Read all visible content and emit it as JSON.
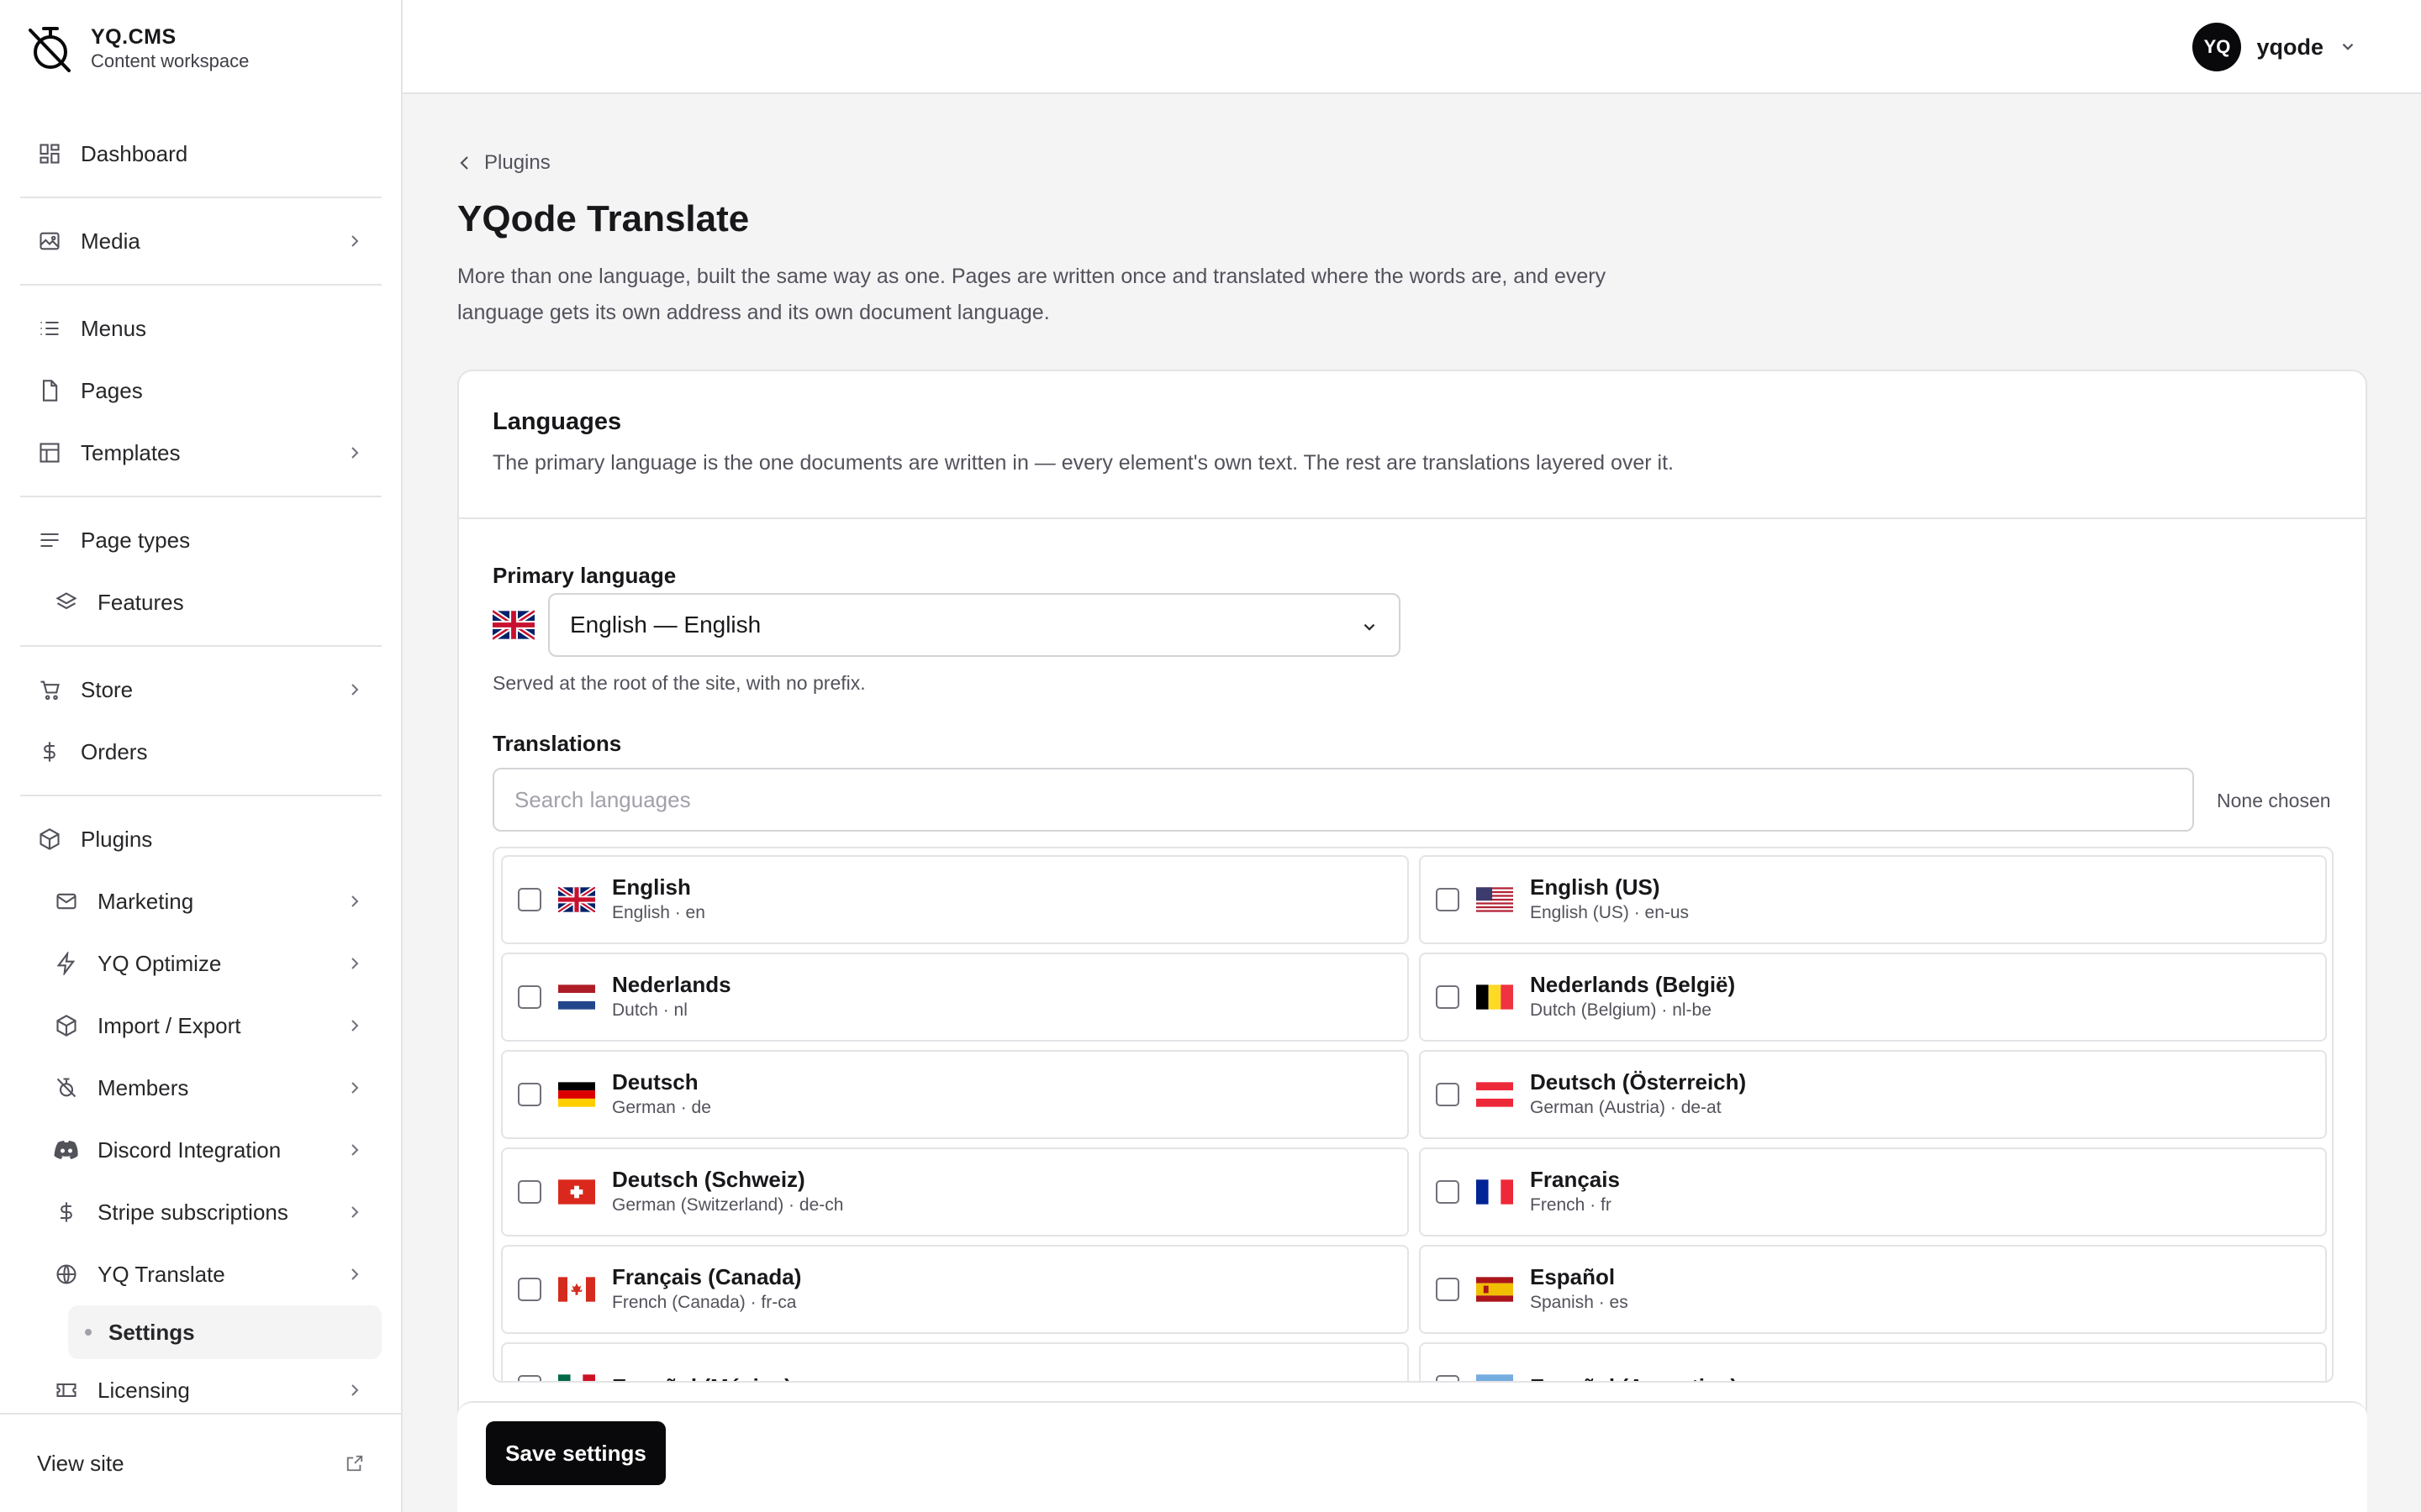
{
  "brand": {
    "name": "YQ.CMS",
    "subtitle": "Content workspace"
  },
  "sidebar": {
    "items": [
      {
        "label": "Dashboard"
      },
      {
        "label": "Media"
      },
      {
        "label": "Menus"
      },
      {
        "label": "Pages"
      },
      {
        "label": "Templates"
      },
      {
        "label": "Page types"
      },
      {
        "label": "Features"
      },
      {
        "label": "Store"
      },
      {
        "label": "Orders"
      },
      {
        "label": "Plugins"
      },
      {
        "label": "Marketing"
      },
      {
        "label": "YQ Optimize"
      },
      {
        "label": "Import / Export"
      },
      {
        "label": "Members"
      },
      {
        "label": "Discord Integration"
      },
      {
        "label": "Stripe subscriptions"
      },
      {
        "label": "YQ Translate"
      },
      {
        "label": "Settings"
      },
      {
        "label": "Licensing"
      }
    ],
    "footer": {
      "label": "View site"
    }
  },
  "user": {
    "initials": "YQ",
    "name": "yqode"
  },
  "page": {
    "breadcrumb": "Plugins",
    "title": "YQode Translate",
    "description": "More than one language, built the same way as one. Pages are written once and translated where the words are, and every language gets its own address and its own document language."
  },
  "languages_card": {
    "title": "Languages",
    "subtitle": "The primary language is the one documents are written in — every element's own text. The rest are translations layered over it.",
    "primary_label": "Primary language",
    "primary_value": "English — English",
    "primary_hint": "Served at the root of the site, with no prefix.",
    "translations_label": "Translations",
    "search_placeholder": "Search languages",
    "none_chosen": "None chosen",
    "languages": [
      {
        "name": "English",
        "meta": "English · en",
        "flag": "gb"
      },
      {
        "name": "English (US)",
        "meta": "English (US) · en-us",
        "flag": "us"
      },
      {
        "name": "Nederlands",
        "meta": "Dutch · nl",
        "flag": "nl"
      },
      {
        "name": "Nederlands (België)",
        "meta": "Dutch (Belgium) · nl-be",
        "flag": "be"
      },
      {
        "name": "Deutsch",
        "meta": "German · de",
        "flag": "de"
      },
      {
        "name": "Deutsch (Österreich)",
        "meta": "German (Austria) · de-at",
        "flag": "at"
      },
      {
        "name": "Deutsch (Schweiz)",
        "meta": "German (Switzerland) · de-ch",
        "flag": "ch"
      },
      {
        "name": "Français",
        "meta": "French · fr",
        "flag": "fr"
      },
      {
        "name": "Français (Canada)",
        "meta": "French (Canada) · fr-ca",
        "flag": "ca"
      },
      {
        "name": "Español",
        "meta": "Spanish · es",
        "flag": "es"
      },
      {
        "name": "Español (México)",
        "meta": "",
        "flag": "mx"
      },
      {
        "name": "Español (Argentina)",
        "meta": "",
        "flag": "ar"
      }
    ],
    "save_label": "Save settings"
  }
}
